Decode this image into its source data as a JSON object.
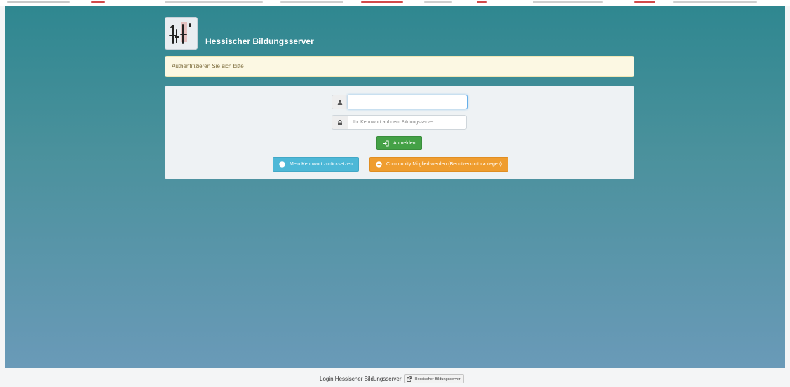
{
  "header": {
    "site_title": "Hessischer Bildungsserver"
  },
  "alert": {
    "message": "Authentifizieren Sie sich bitte"
  },
  "login_form": {
    "username": {
      "value": "",
      "placeholder": "",
      "icon": "user-icon"
    },
    "password": {
      "value": "",
      "placeholder": "Ihr Kennwort auf dem Bildungsserver",
      "icon": "lock-icon"
    },
    "submit_label": "Anmelden",
    "submit_icon": "login-icon"
  },
  "actions": {
    "reset_password_label": "Mein Kennwort zurücksetzen",
    "reset_password_icon": "info-circle-icon",
    "register_label": "Community Mitglied werden (Benutzerkonto anlegen)",
    "register_icon": "plus-circle-icon"
  },
  "footer": {
    "text": "Login Hessischer Bildungsserver",
    "link_label": "Hessischer Bildungsserver",
    "link_icon": "external-link-icon"
  },
  "colors": {
    "background_top": "#2f8790",
    "background_bottom": "#6a9ab8",
    "alert_bg": "#fcf8e3",
    "success": "#44a146",
    "info": "#4db8d7",
    "warning": "#ef9d2f"
  }
}
